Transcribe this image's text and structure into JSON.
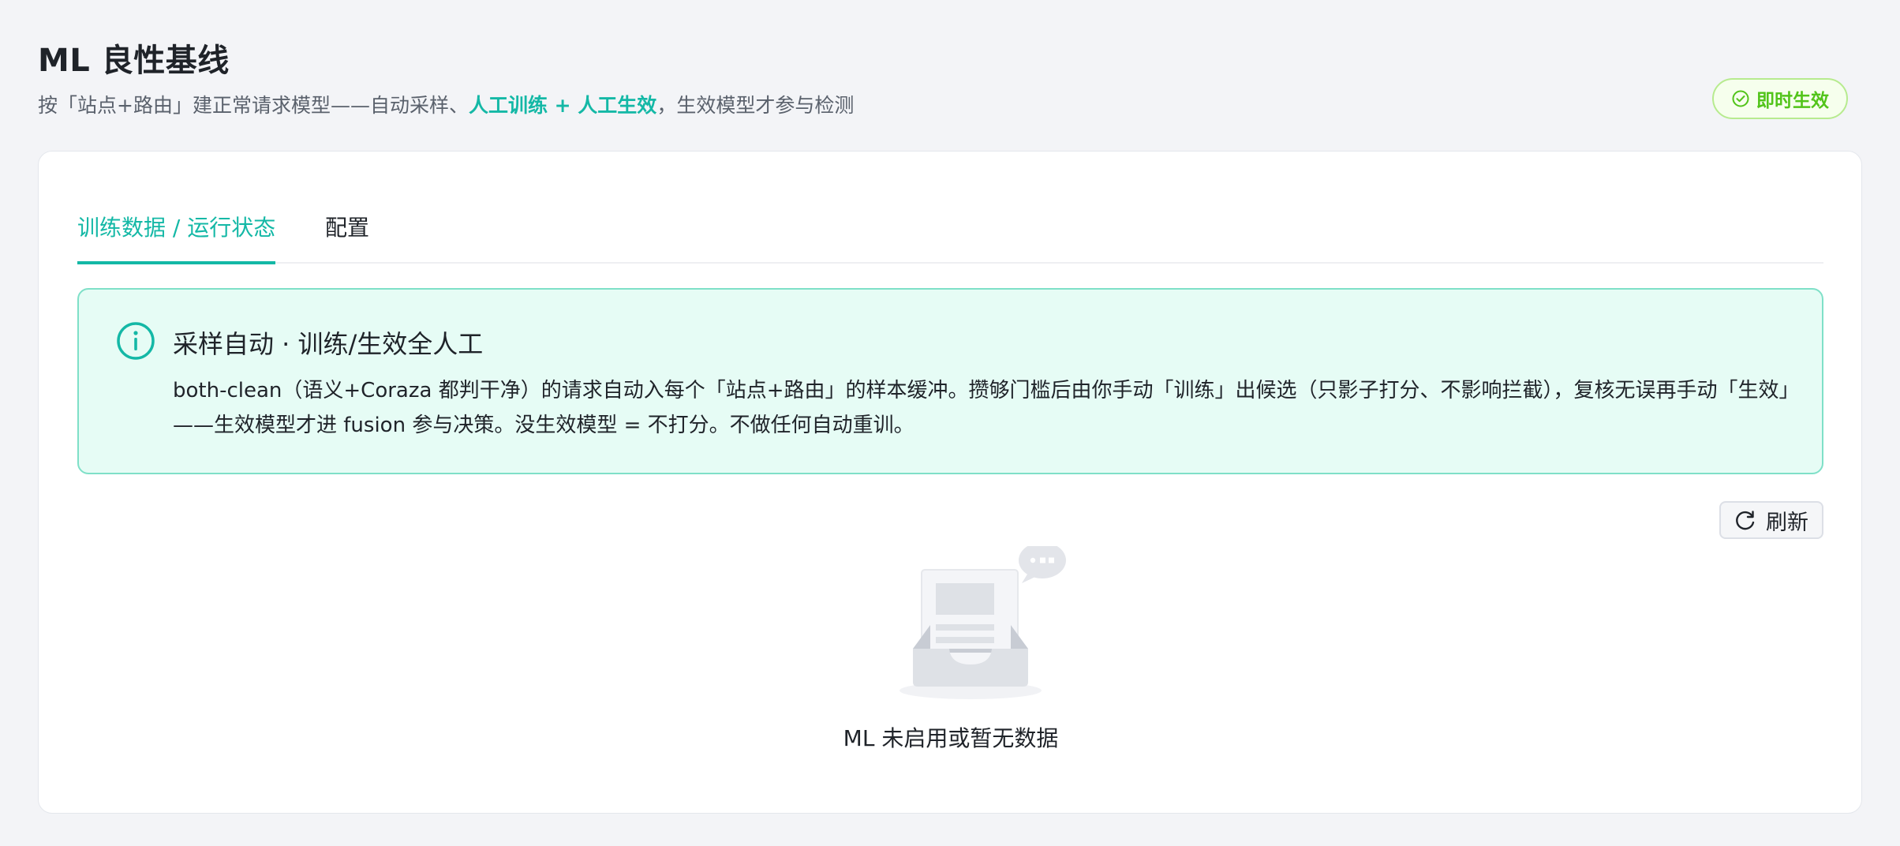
{
  "header": {
    "title": "ML 良性基线",
    "subtitle_prefix": "按「站点+路由」建正常请求模型——自动采样、",
    "subtitle_highlight": "人工训练 + 人工生效",
    "subtitle_suffix": "，生效模型才参与检测",
    "badge_label": "即时生效"
  },
  "tabs": [
    {
      "label": "训练数据 / 运行状态",
      "active": true
    },
    {
      "label": "配置",
      "active": false
    }
  ],
  "info": {
    "title": "采样自动 · 训练/生效全人工",
    "body": "both-clean（语义+Coraza 都判干净）的请求自动入每个「站点+路由」的样本缓冲。攒够门槛后由你手动「训练」出候选（只影子打分、不影响拦截），复核无误再手动「生效」——生效模型才进 fusion 参与决策。没生效模型 = 不打分。不做任何自动重训。"
  },
  "toolbar": {
    "refresh_label": "刷新"
  },
  "empty_state": {
    "text": "ML 未启用或暂无数据"
  },
  "colors": {
    "accent": "#14b8a6",
    "success": "#52c41a",
    "info_bg": "#e6fcf5",
    "info_border": "#7fe0c8"
  },
  "icons": {
    "badge": "check-circle-icon",
    "info": "info-circle-icon",
    "refresh": "refresh-icon",
    "empty": "empty-inbox-icon"
  }
}
